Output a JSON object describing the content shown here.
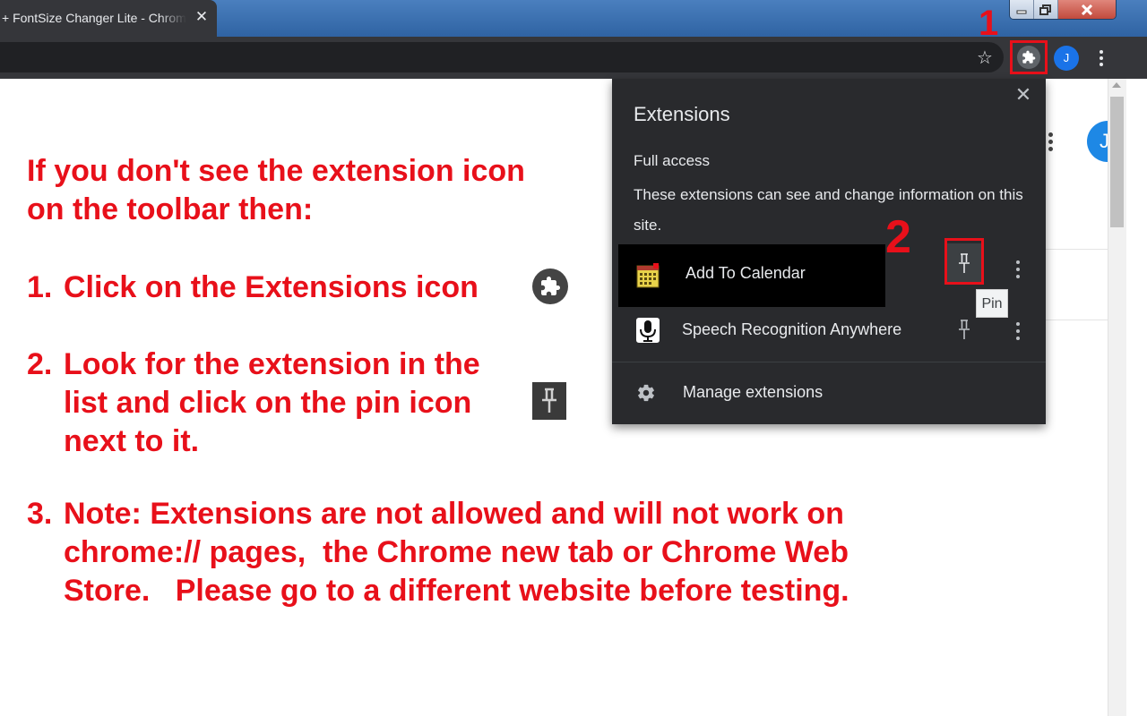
{
  "browser": {
    "tab_title": "+ FontSize Changer Lite - Chrome Web Store",
    "tab_close": "✕",
    "profile_initial": "J"
  },
  "page": {
    "avatar_initial": "J"
  },
  "instructions": {
    "intro_line1": "If you don't see the extension icon",
    "intro_line2": "on the toolbar then:",
    "step1_num": "1.",
    "step1_text": "Click on the Extensions icon",
    "step2_num": "2.",
    "step2_line1": "Look for the extension in the",
    "step2_line2": "list and click on the pin icon",
    "step2_line3": "next to it.",
    "step3_num": "3.",
    "step3_line1": "Note: Extensions are not allowed and will not work on",
    "step3_line2": "chrome:// pages,  the Chrome new tab or Chrome Web",
    "step3_line3": "Store.   Please go to a different website before testing."
  },
  "markers": {
    "marker1": "1",
    "marker2": "2"
  },
  "extensions_popup": {
    "title": "Extensions",
    "close": "✕",
    "section_title": "Full access",
    "section_desc": "These extensions can see and change information on this site.",
    "items": [
      {
        "name": "Add To Calendar",
        "icon": "calendar-icon",
        "pinned_hover": true
      },
      {
        "name": "Speech Recognition Anywhere",
        "icon": "microphone-icon",
        "pinned_hover": false
      }
    ],
    "pin_tooltip": "Pin",
    "manage_label": "Manage extensions"
  },
  "colors": {
    "annotation_red": "#e8101a",
    "toolbar_dark": "#35363a",
    "popup_bg": "#292a2d",
    "accent_blue": "#1a73e8"
  }
}
